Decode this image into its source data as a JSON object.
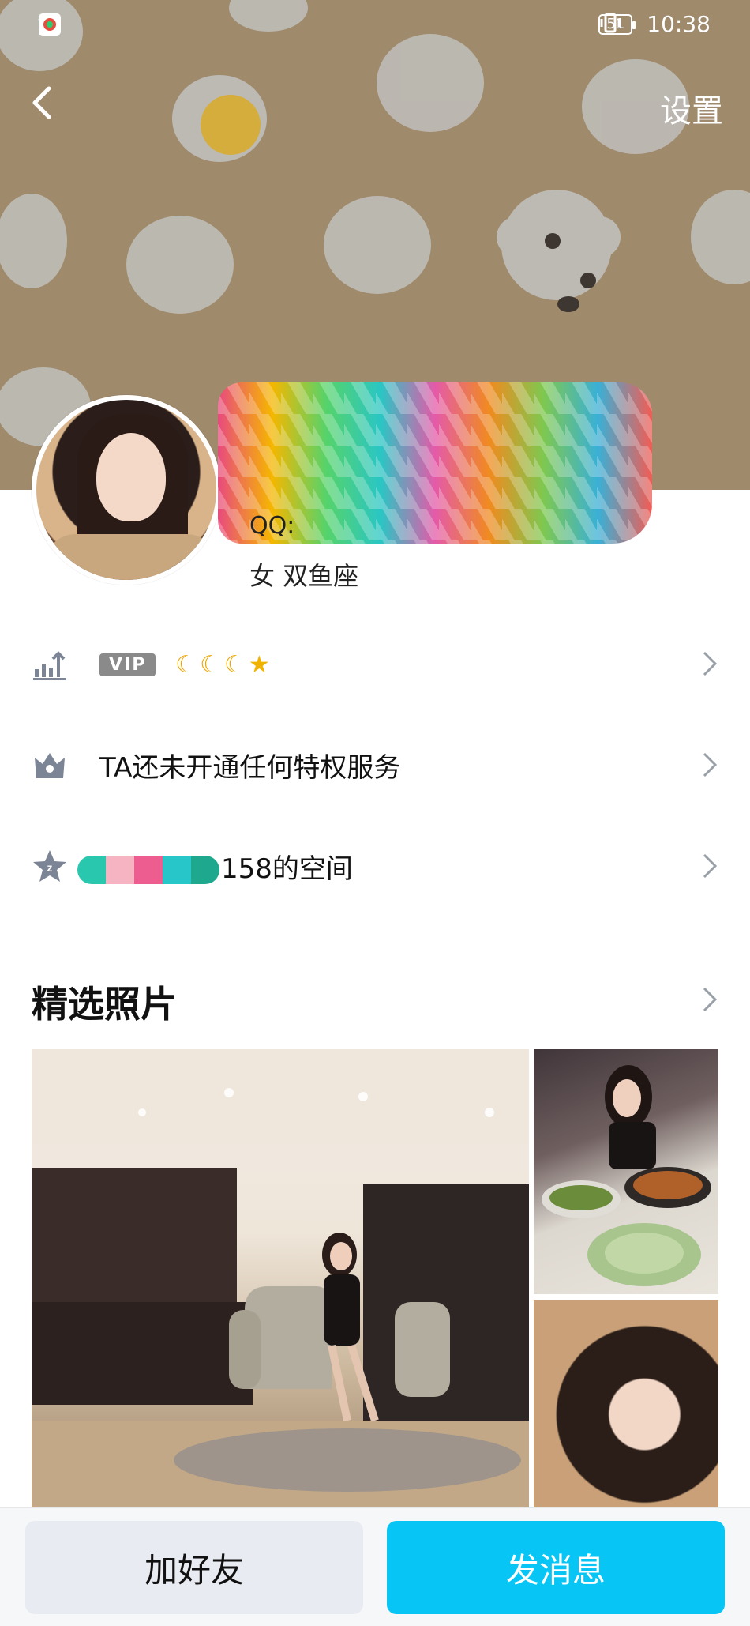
{
  "status_bar": {
    "network": "4G",
    "battery": "51",
    "time": "10:38"
  },
  "header": {
    "settings_label": "设置"
  },
  "profile": {
    "qq_prefix": "QQ:",
    "gender_sign": "女  双鱼座"
  },
  "rows": {
    "vip_badge": "VIP",
    "privilege_text": "TA还未开通任何特权服务",
    "zone_suffix": "158的空间"
  },
  "photos": {
    "section_title": "精选照片"
  },
  "actions": {
    "add_friend": "加好友",
    "send_message": "发消息"
  },
  "colors": {
    "cover_bg": "#a08a6c",
    "primary_button": "#07c6f6",
    "secondary_button": "#e9ebf2"
  }
}
